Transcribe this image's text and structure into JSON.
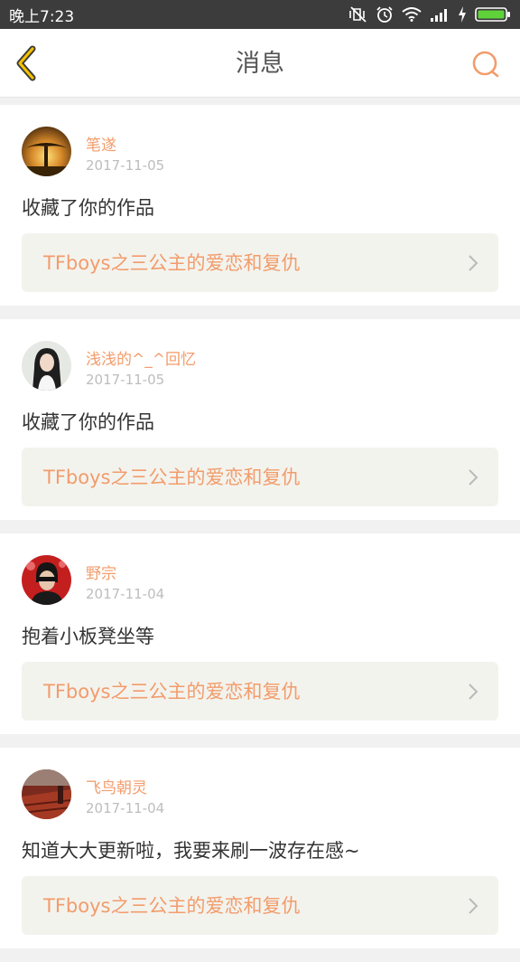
{
  "status_bar": {
    "time": "晚上7:23"
  },
  "nav": {
    "title": "消息",
    "back_icon": "chevron-left-icon",
    "search_icon": "search-icon",
    "accent_color": "#f29c6b",
    "back_color": "#f2c100"
  },
  "messages": [
    {
      "username": "笔遂",
      "date": "2017-11-05",
      "comment": "收藏了你的作品",
      "work_title": "TFboys之三公主的爱恋和复仇"
    },
    {
      "username": "浅浅的^_^回忆",
      "date": "2017-11-05",
      "comment": "收藏了你的作品",
      "work_title": "TFboys之三公主的爱恋和复仇"
    },
    {
      "username": "野宗",
      "date": "2017-11-04",
      "comment": "抱着小板凳坐等",
      "work_title": "TFboys之三公主的爱恋和复仇"
    },
    {
      "username": "飞鸟朝灵",
      "date": "2017-11-04",
      "comment": "知道大大更新啦，我要来刷一波存在感~",
      "work_title": "TFboys之三公主的爱恋和复仇"
    }
  ]
}
